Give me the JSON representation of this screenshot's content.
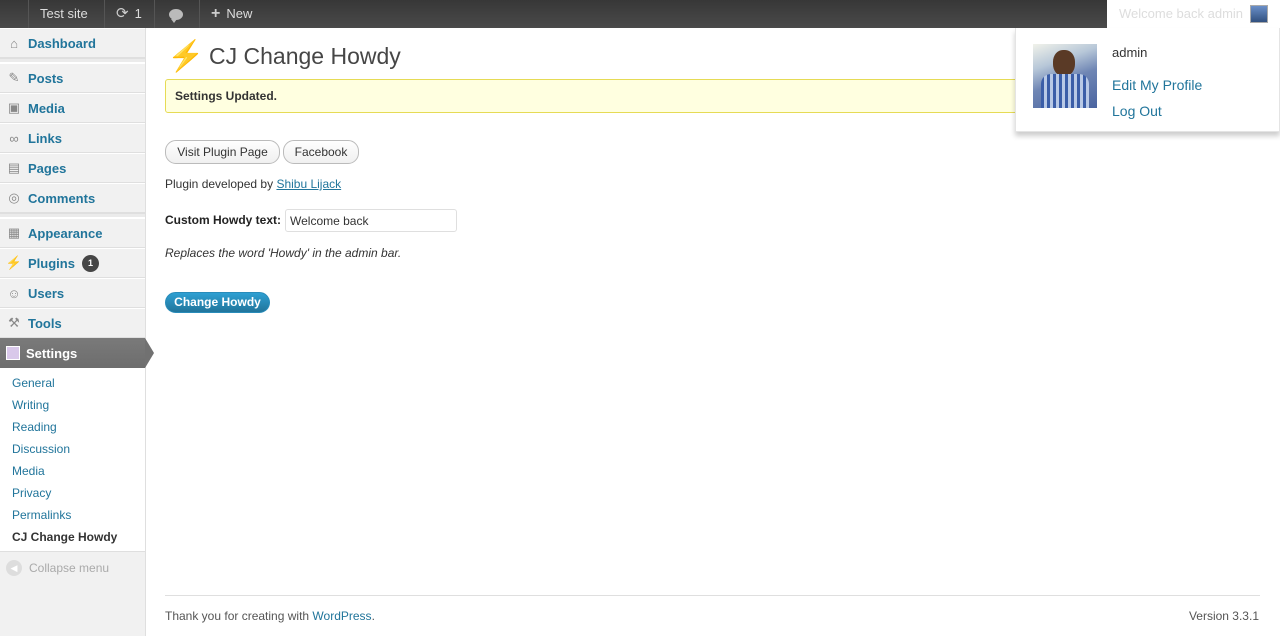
{
  "adminbar": {
    "site_name": "Test site",
    "updates_count": "1",
    "new_label": "New",
    "account_text": "Welcome back admin"
  },
  "account_menu": {
    "username": "admin",
    "edit_profile": "Edit My Profile",
    "log_out": "Log Out"
  },
  "sidebar": {
    "items": [
      {
        "label": "Dashboard",
        "icon": "dashboard-icon"
      },
      {
        "label": "Posts",
        "icon": "pushpin-icon"
      },
      {
        "label": "Media",
        "icon": "media-icon"
      },
      {
        "label": "Links",
        "icon": "link-icon"
      },
      {
        "label": "Pages",
        "icon": "pages-icon"
      },
      {
        "label": "Comments",
        "icon": "comment-icon"
      },
      {
        "label": "Appearance",
        "icon": "appearance-icon"
      },
      {
        "label": "Plugins",
        "icon": "plugin-icon",
        "badge": "1"
      },
      {
        "label": "Users",
        "icon": "users-icon"
      },
      {
        "label": "Tools",
        "icon": "tools-icon"
      },
      {
        "label": "Settings",
        "icon": "settings-icon"
      }
    ],
    "submenu": [
      "General",
      "Writing",
      "Reading",
      "Discussion",
      "Media",
      "Privacy",
      "Permalinks",
      "CJ Change Howdy"
    ],
    "collapse_label": "Collapse menu"
  },
  "main": {
    "title": "CJ Change Howdy",
    "notice": "Settings Updated.",
    "visit_plugin_button": "Visit Plugin Page",
    "facebook_button": "Facebook",
    "developed_by_text": "Plugin developed by",
    "developer_name": "Shibu Lijack",
    "howdy_label": "Custom Howdy text:",
    "howdy_value": "Welcome back",
    "howdy_description": "Replaces the word 'Howdy' in the admin bar.",
    "submit_button": "Change Howdy"
  },
  "footer": {
    "thanks_text": "Thank you for creating with",
    "wordpress_link": "WordPress",
    "thanks_suffix": ".",
    "version": "Version 3.3.1"
  },
  "colors": {
    "link": "#21759b",
    "adminbar_bg": "#464646",
    "notice_bg": "#ffffe0",
    "primary_button": "#21759b"
  }
}
